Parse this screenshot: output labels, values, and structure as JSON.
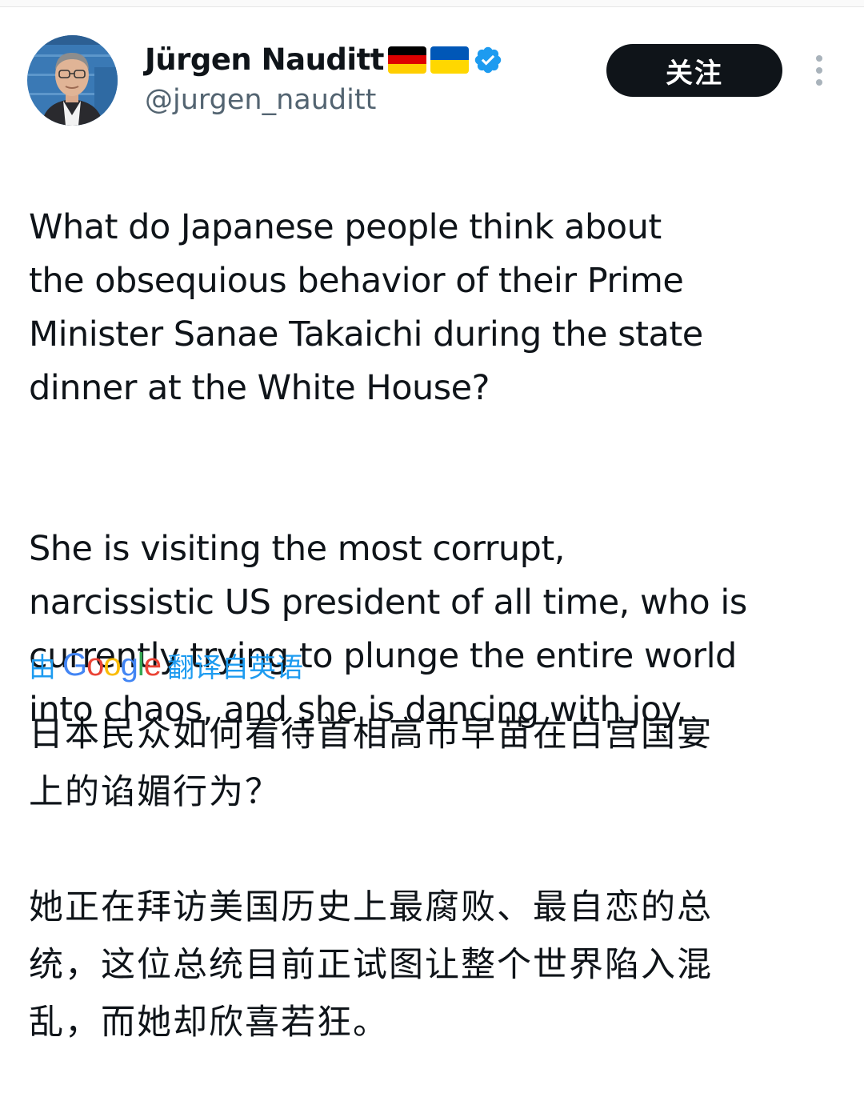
{
  "author": {
    "display_name": "Jürgen Nauditt",
    "handle": "@jurgen_nauditt",
    "flags": [
      "germany-flag",
      "ukraine-flag"
    ],
    "verified_badge": "verified-icon"
  },
  "follow_button_label": "关注",
  "tweet": {
    "paragraphs": [
      "What do Japanese people think about\nthe obsequious behavior of their Prime\nMinister Sanae Takaichi during the state\ndinner at the White House?",
      "She is visiting the most corrupt,\nnarcissistic US president of all time, who is\ncurrently trying to plunge the entire world\ninto chaos, and she is dancing with joy."
    ]
  },
  "translation": {
    "prefix": "由",
    "provider": "Google",
    "suffix": "翻译自英语",
    "paragraphs": [
      "日本民众如何看待首相高市早苗在白宫国宴\n上的谄媚行为？",
      "她正在拜访美国历史上最腐败、最自恋的总\n统，这位总统目前正试图让整个世界陷入混\n乱，而她却欣喜若狂。"
    ]
  },
  "colors": {
    "link_blue": "#1d9bf0",
    "text": "#0f1419",
    "secondary": "#536471",
    "button_bg": "#0f1419"
  }
}
